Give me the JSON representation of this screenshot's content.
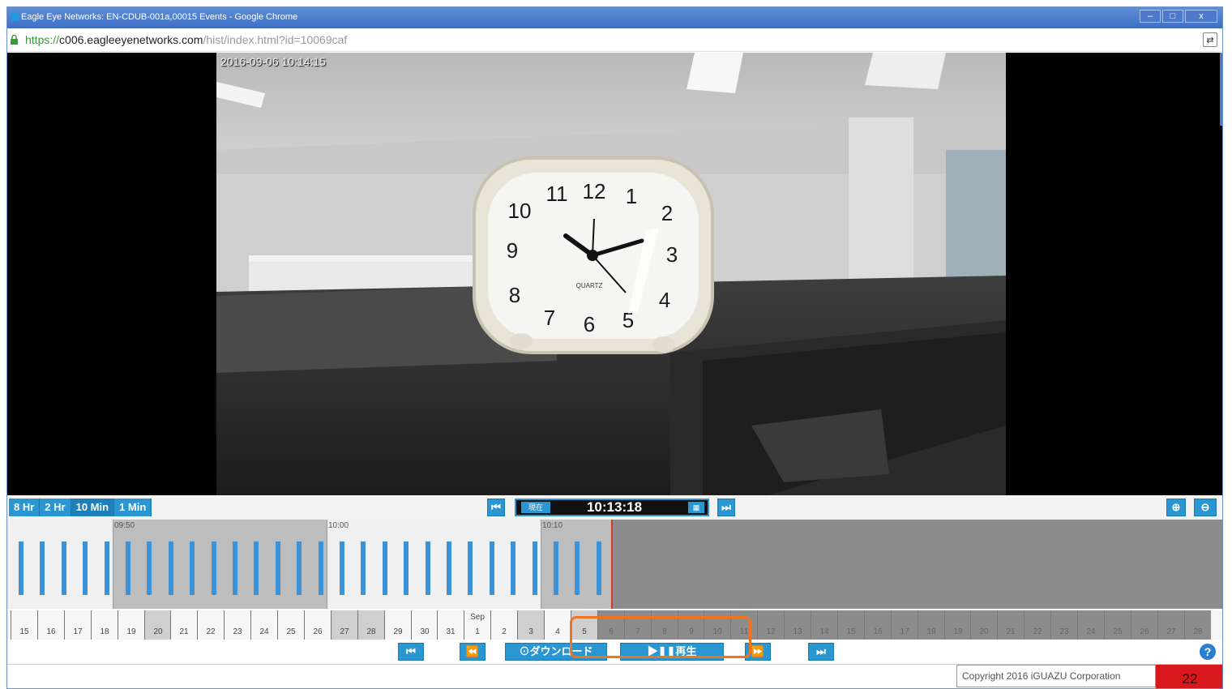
{
  "window": {
    "title": "Eagle Eye Networks: EN-CDUB-001a,00015 Events - Google Chrome",
    "buttons": [
      "–",
      "□",
      "x"
    ]
  },
  "address": {
    "scheme": "https://",
    "host": "c006.eagleeyenetworks.com",
    "path": "/hist/index.html?id=10069caf",
    "translate_icon": "translate-icon"
  },
  "video": {
    "timestamp": "2016-09-06 10:14:15",
    "clock_numerals": [
      "12",
      "1",
      "2",
      "3",
      "4",
      "5",
      "6",
      "7",
      "8",
      "9",
      "10",
      "11"
    ],
    "clock_brand": "QUARTZ"
  },
  "controls": {
    "zoom_options": [
      "8 Hr",
      "2 Hr",
      "10 Min",
      "1 Min"
    ],
    "active_zoom": "10 Min",
    "prev_icon": "skip-start-icon",
    "now_label": "現在",
    "current_time": "10:13:18",
    "calendar_icon": "calendar-icon",
    "next_icon": "skip-end-icon",
    "zoom_in_icon": "zoom-in-icon",
    "zoom_out_icon": "zoom-out-icon"
  },
  "timeline": {
    "time_labels": [
      "09:50",
      "10:00",
      "10:10"
    ],
    "month_label": "Sep",
    "days": [
      "15",
      "16",
      "17",
      "18",
      "19",
      "20",
      "21",
      "22",
      "23",
      "24",
      "25",
      "26",
      "27",
      "28",
      "29",
      "30",
      "31",
      "1",
      "2",
      "3",
      "4",
      "5",
      "6",
      "7",
      "8",
      "9",
      "10",
      "11",
      "12",
      "13",
      "14",
      "15",
      "16",
      "17",
      "18",
      "19",
      "20",
      "21",
      "22",
      "23",
      "24",
      "25",
      "26",
      "27",
      "28"
    ]
  },
  "playback": {
    "first_label": "⏮",
    "back_label": "⏪",
    "download_label": "⊙ダウンロード",
    "play_label": "▶❚❚再生",
    "fwd_label": "⏩",
    "last_label": "⏭",
    "help_label": "?"
  },
  "footer": {
    "copyright": "Copyright 2016 iGUAZU Corporation",
    "page_number": "22"
  },
  "colors": {
    "accent": "#2a96d2",
    "highlight": "#f0731e",
    "page_badge": "#d8181c"
  }
}
